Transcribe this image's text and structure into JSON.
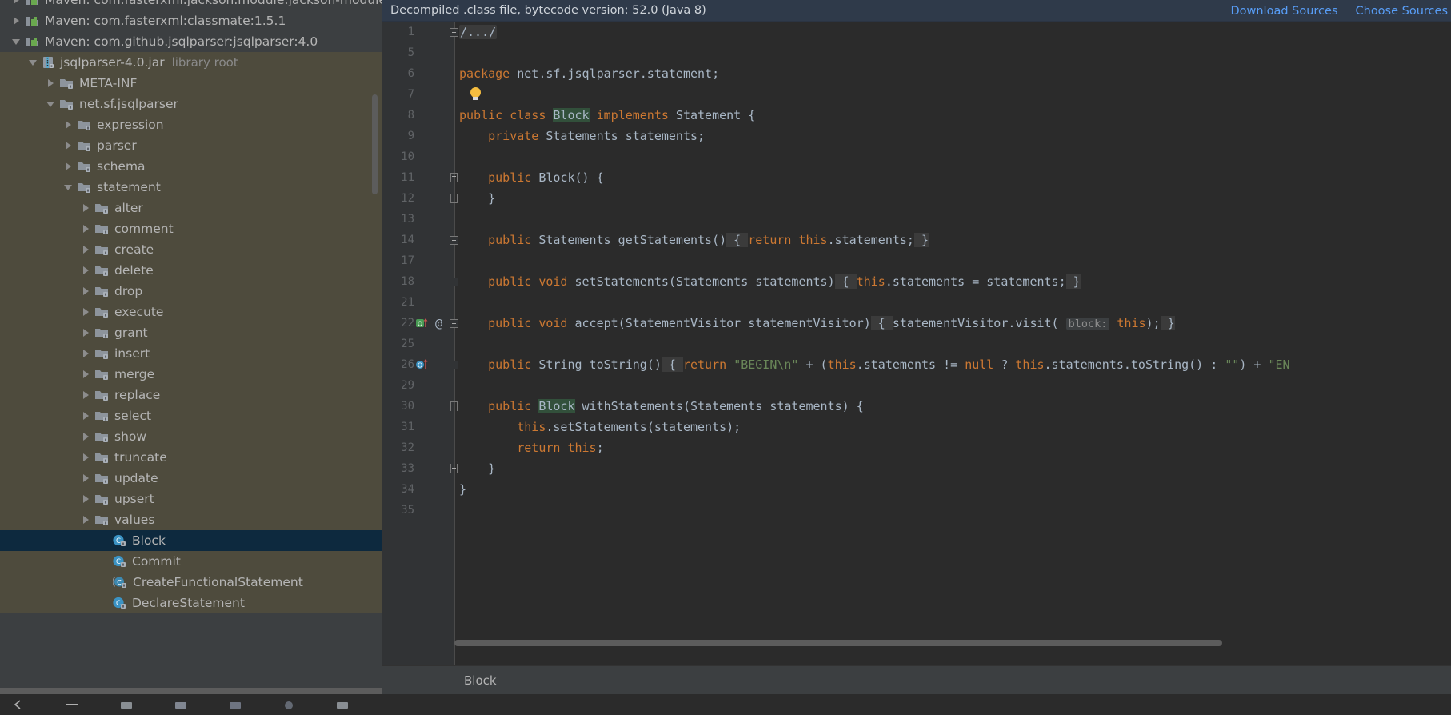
{
  "sidebar": {
    "items": [
      {
        "label": "Maven: com.fasterxml.jackson.module:jackson-module",
        "icon": "maven-library-icon",
        "arrow": "collapsed",
        "indent": 36,
        "kind": "maven",
        "bg": "maven",
        "clipped": true
      },
      {
        "label": "Maven: com.fasterxml:classmate:1.5.1",
        "icon": "maven-library-icon",
        "arrow": "collapsed",
        "indent": 36,
        "kind": "maven",
        "bg": "maven"
      },
      {
        "label": "Maven: com.github.jsqlparser:jsqlparser:4.0",
        "icon": "maven-library-icon",
        "arrow": "expanded",
        "indent": 36,
        "kind": "maven",
        "bg": "maven"
      },
      {
        "label": "jsqlparser-4.0.jar",
        "suffix": "library root",
        "icon": "jar-icon",
        "arrow": "expanded",
        "indent": 57,
        "kind": "jar",
        "bg": "jar"
      },
      {
        "label": "META-INF",
        "icon": "folder-locked-icon",
        "arrow": "collapsed",
        "indent": 79,
        "kind": "folder",
        "bg": "jar"
      },
      {
        "label": "net.sf.jsqlparser",
        "icon": "folder-locked-icon",
        "arrow": "expanded",
        "indent": 79,
        "kind": "folder",
        "bg": "jar"
      },
      {
        "label": "expression",
        "icon": "folder-locked-icon",
        "arrow": "collapsed",
        "indent": 101,
        "kind": "folder",
        "bg": "jar"
      },
      {
        "label": "parser",
        "icon": "folder-locked-icon",
        "arrow": "collapsed",
        "indent": 101,
        "kind": "folder",
        "bg": "jar"
      },
      {
        "label": "schema",
        "icon": "folder-locked-icon",
        "arrow": "collapsed",
        "indent": 101,
        "kind": "folder",
        "bg": "jar"
      },
      {
        "label": "statement",
        "icon": "folder-locked-icon",
        "arrow": "expanded",
        "indent": 101,
        "kind": "folder",
        "bg": "jar"
      },
      {
        "label": "alter",
        "icon": "folder-locked-icon",
        "arrow": "collapsed",
        "indent": 123,
        "kind": "folder",
        "bg": "jar"
      },
      {
        "label": "comment",
        "icon": "folder-locked-icon",
        "arrow": "collapsed",
        "indent": 123,
        "kind": "folder",
        "bg": "jar"
      },
      {
        "label": "create",
        "icon": "folder-locked-icon",
        "arrow": "collapsed",
        "indent": 123,
        "kind": "folder",
        "bg": "jar"
      },
      {
        "label": "delete",
        "icon": "folder-locked-icon",
        "arrow": "collapsed",
        "indent": 123,
        "kind": "folder",
        "bg": "jar"
      },
      {
        "label": "drop",
        "icon": "folder-locked-icon",
        "arrow": "collapsed",
        "indent": 123,
        "kind": "folder",
        "bg": "jar"
      },
      {
        "label": "execute",
        "icon": "folder-locked-icon",
        "arrow": "collapsed",
        "indent": 123,
        "kind": "folder",
        "bg": "jar"
      },
      {
        "label": "grant",
        "icon": "folder-locked-icon",
        "arrow": "collapsed",
        "indent": 123,
        "kind": "folder",
        "bg": "jar"
      },
      {
        "label": "insert",
        "icon": "folder-locked-icon",
        "arrow": "collapsed",
        "indent": 123,
        "kind": "folder",
        "bg": "jar"
      },
      {
        "label": "merge",
        "icon": "folder-locked-icon",
        "arrow": "collapsed",
        "indent": 123,
        "kind": "folder",
        "bg": "jar"
      },
      {
        "label": "replace",
        "icon": "folder-locked-icon",
        "arrow": "collapsed",
        "indent": 123,
        "kind": "folder",
        "bg": "jar"
      },
      {
        "label": "select",
        "icon": "folder-locked-icon",
        "arrow": "collapsed",
        "indent": 123,
        "kind": "folder",
        "bg": "jar"
      },
      {
        "label": "show",
        "icon": "folder-locked-icon",
        "arrow": "collapsed",
        "indent": 123,
        "kind": "folder",
        "bg": "jar"
      },
      {
        "label": "truncate",
        "icon": "folder-locked-icon",
        "arrow": "collapsed",
        "indent": 123,
        "kind": "folder",
        "bg": "jar"
      },
      {
        "label": "update",
        "icon": "folder-locked-icon",
        "arrow": "collapsed",
        "indent": 123,
        "kind": "folder",
        "bg": "jar"
      },
      {
        "label": "upsert",
        "icon": "folder-locked-icon",
        "arrow": "collapsed",
        "indent": 123,
        "kind": "folder",
        "bg": "jar"
      },
      {
        "label": "values",
        "icon": "folder-locked-icon",
        "arrow": "collapsed",
        "indent": 123,
        "kind": "folder",
        "bg": "jar"
      },
      {
        "label": "Block",
        "icon": "class-locked-icon",
        "arrow": "none",
        "indent": 145,
        "kind": "class",
        "bg": "selected",
        "selected": true
      },
      {
        "label": "Commit",
        "icon": "class-locked-icon",
        "arrow": "none",
        "indent": 145,
        "kind": "class",
        "bg": "jar"
      },
      {
        "label": "CreateFunctionalStatement",
        "icon": "class-abstract-locked-icon",
        "arrow": "none",
        "indent": 145,
        "kind": "class",
        "bg": "jar"
      },
      {
        "label": "DeclareStatement",
        "icon": "class-locked-icon",
        "arrow": "none",
        "indent": 145,
        "kind": "class",
        "bg": "jar"
      }
    ]
  },
  "notification": {
    "message": "Decompiled .class file, bytecode version: 52.0 (Java 8)",
    "download_sources": "Download Sources",
    "choose_sources": "Choose Sources"
  },
  "editor": {
    "lines": [
      {
        "num": "1",
        "fold": "plus",
        "text_html": "<span class=\"folded-text\">/.../</span>"
      },
      {
        "num": "5",
        "fold": "",
        "text_html": ""
      },
      {
        "num": "6",
        "fold": "",
        "text_html": "<span class=\"kw\">package</span> net.sf.jsqlparser.statement;"
      },
      {
        "num": "7",
        "fold": "",
        "text_html": "",
        "bulb": true
      },
      {
        "num": "8",
        "fold": "",
        "text_html": "<span class=\"kw\">public</span> <span class=\"kw\">class</span> <span class=\"hl-class\">Block</span> <span class=\"kw\">implements</span> Statement {"
      },
      {
        "num": "9",
        "fold": "",
        "text_html": "    <span class=\"kw\">private</span> Statements statements;"
      },
      {
        "num": "10",
        "fold": "",
        "text_html": ""
      },
      {
        "num": "11",
        "fold": "top",
        "text_html": "    <span class=\"kw\">public</span> Block() {"
      },
      {
        "num": "12",
        "fold": "bot",
        "text_html": "    }"
      },
      {
        "num": "13",
        "fold": "",
        "text_html": ""
      },
      {
        "num": "14",
        "fold": "plus",
        "text_html": "    <span class=\"kw\">public</span> Statements getStatements()<span class=\"brace-hl\"> { </span><span class=\"kw\">return</span> <span class=\"kw\">this</span>.statements;<span class=\"brace-hl\"> }</span>"
      },
      {
        "num": "17",
        "fold": "",
        "text_html": ""
      },
      {
        "num": "18",
        "fold": "plus",
        "text_html": "    <span class=\"kw\">public</span> <span class=\"kw\">void</span> setStatements(Statements statements)<span class=\"brace-hl\"> { </span><span class=\"kw\">this</span>.statements = statements;<span class=\"brace-hl\"> }</span>"
      },
      {
        "num": "21",
        "fold": "",
        "text_html": ""
      },
      {
        "num": "22",
        "fold": "plus",
        "gutter_run": true,
        "gutter_at": "@",
        "text_html": "    <span class=\"kw\">public</span> <span class=\"kw\">void</span> accept(StatementVisitor statementVisitor)<span class=\"brace-hl\"> { </span>statementVisitor.visit( <span class=\"hint\">block:</span> <span class=\"kw\">this</span>);<span class=\"brace-hl\"> }</span>"
      },
      {
        "num": "25",
        "fold": "",
        "text_html": ""
      },
      {
        "num": "26",
        "fold": "plus",
        "gutter_override": true,
        "text_html": "    <span class=\"kw\">public</span> String toString()<span class=\"brace-hl\"> { </span><span class=\"kw\">return</span> <span class=\"str\">\"BEGIN\\n\"</span> + (<span class=\"kw\">this</span>.statements != <span class=\"kw\">null</span> ? <span class=\"kw\">this</span>.statements.toString() : <span class=\"str\">\"\"</span>) + <span class=\"str\">\"EN</span>"
      },
      {
        "num": "29",
        "fold": "",
        "text_html": ""
      },
      {
        "num": "30",
        "fold": "top",
        "text_html": "    <span class=\"kw\">public</span> <span class=\"hl-class\">Block</span> withStatements(Statements statements) {"
      },
      {
        "num": "31",
        "fold": "",
        "text_html": "        <span class=\"kw\">this</span>.setStatements(statements);"
      },
      {
        "num": "32",
        "fold": "",
        "text_html": "        <span class=\"kw\">return</span> <span class=\"kw\">this</span>;"
      },
      {
        "num": "33",
        "fold": "bot",
        "text_html": "    }"
      },
      {
        "num": "34",
        "fold": "",
        "text_html": "}"
      },
      {
        "num": "35",
        "fold": "",
        "text_html": ""
      }
    ]
  },
  "status": {
    "breadcrumb": "Block"
  },
  "colors": {
    "accent_link": "#589df6",
    "selection": "#0d293e",
    "jar_bg": "#4e4b3d",
    "panel_bg": "#3c3f41",
    "editor_bg": "#2b2b2b",
    "keyword": "#cc7832",
    "string": "#6a8759",
    "text": "#a9b7c6",
    "notification_bg": "#2f3a4a"
  }
}
